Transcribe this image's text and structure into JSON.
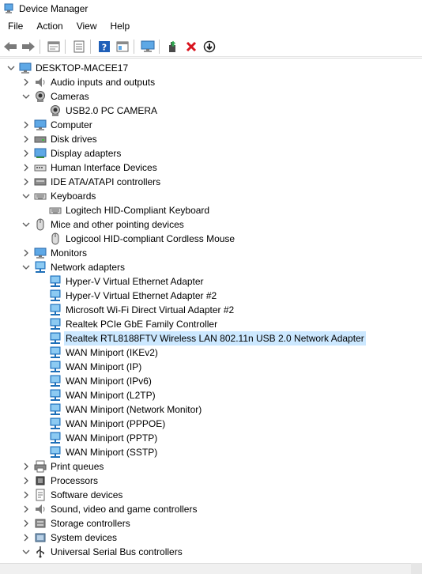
{
  "window": {
    "title": "Device Manager"
  },
  "menu": [
    "File",
    "Action",
    "View",
    "Help"
  ],
  "toolbar": [
    "back",
    "forward",
    "properties-sheet",
    "list-view",
    "help",
    "resource-view",
    "scan-hardware",
    "update-driver",
    "uninstall",
    "disable"
  ],
  "tree": [
    {
      "label": "DESKTOP-MACEE17",
      "level": 0,
      "expander": "expanded",
      "icon": "computer-root"
    },
    {
      "label": "Audio inputs and outputs",
      "level": 1,
      "expander": "collapsed",
      "icon": "speaker"
    },
    {
      "label": "Cameras",
      "level": 1,
      "expander": "expanded",
      "icon": "camera"
    },
    {
      "label": "USB2.0 PC CAMERA",
      "level": 2,
      "expander": "none",
      "icon": "camera"
    },
    {
      "label": "Computer",
      "level": 1,
      "expander": "collapsed",
      "icon": "monitor"
    },
    {
      "label": "Disk drives",
      "level": 1,
      "expander": "collapsed",
      "icon": "disk"
    },
    {
      "label": "Display adapters",
      "level": 1,
      "expander": "collapsed",
      "icon": "display"
    },
    {
      "label": "Human Interface Devices",
      "level": 1,
      "expander": "collapsed",
      "icon": "hid"
    },
    {
      "label": "IDE ATA/ATAPI controllers",
      "level": 1,
      "expander": "collapsed",
      "icon": "ide"
    },
    {
      "label": "Keyboards",
      "level": 1,
      "expander": "expanded",
      "icon": "keyboard"
    },
    {
      "label": "Logitech HID-Compliant Keyboard",
      "level": 2,
      "expander": "none",
      "icon": "keyboard"
    },
    {
      "label": "Mice and other pointing devices",
      "level": 1,
      "expander": "expanded",
      "icon": "mouse"
    },
    {
      "label": "Logicool HID-compliant Cordless Mouse",
      "level": 2,
      "expander": "none",
      "icon": "mouse"
    },
    {
      "label": "Monitors",
      "level": 1,
      "expander": "collapsed",
      "icon": "monitor"
    },
    {
      "label": "Network adapters",
      "level": 1,
      "expander": "expanded",
      "icon": "network"
    },
    {
      "label": "Hyper-V Virtual Ethernet Adapter",
      "level": 2,
      "expander": "none",
      "icon": "network"
    },
    {
      "label": "Hyper-V Virtual Ethernet Adapter #2",
      "level": 2,
      "expander": "none",
      "icon": "network"
    },
    {
      "label": "Microsoft Wi-Fi Direct Virtual Adapter #2",
      "level": 2,
      "expander": "none",
      "icon": "network"
    },
    {
      "label": "Realtek PCIe GbE Family Controller",
      "level": 2,
      "expander": "none",
      "icon": "network"
    },
    {
      "label": "Realtek RTL8188FTV Wireless LAN 802.11n USB 2.0 Network Adapter",
      "level": 2,
      "expander": "none",
      "icon": "network",
      "selected": true
    },
    {
      "label": "WAN Miniport (IKEv2)",
      "level": 2,
      "expander": "none",
      "icon": "network"
    },
    {
      "label": "WAN Miniport (IP)",
      "level": 2,
      "expander": "none",
      "icon": "network"
    },
    {
      "label": "WAN Miniport (IPv6)",
      "level": 2,
      "expander": "none",
      "icon": "network"
    },
    {
      "label": "WAN Miniport (L2TP)",
      "level": 2,
      "expander": "none",
      "icon": "network"
    },
    {
      "label": "WAN Miniport (Network Monitor)",
      "level": 2,
      "expander": "none",
      "icon": "network"
    },
    {
      "label": "WAN Miniport (PPPOE)",
      "level": 2,
      "expander": "none",
      "icon": "network"
    },
    {
      "label": "WAN Miniport (PPTP)",
      "level": 2,
      "expander": "none",
      "icon": "network"
    },
    {
      "label": "WAN Miniport (SSTP)",
      "level": 2,
      "expander": "none",
      "icon": "network"
    },
    {
      "label": "Print queues",
      "level": 1,
      "expander": "collapsed",
      "icon": "printer"
    },
    {
      "label": "Processors",
      "level": 1,
      "expander": "collapsed",
      "icon": "processor"
    },
    {
      "label": "Software devices",
      "level": 1,
      "expander": "collapsed",
      "icon": "software"
    },
    {
      "label": "Sound, video and game controllers",
      "level": 1,
      "expander": "collapsed",
      "icon": "speaker"
    },
    {
      "label": "Storage controllers",
      "level": 1,
      "expander": "collapsed",
      "icon": "storage"
    },
    {
      "label": "System devices",
      "level": 1,
      "expander": "collapsed",
      "icon": "system"
    },
    {
      "label": "Universal Serial Bus controllers",
      "level": 1,
      "expander": "expanded",
      "icon": "usb"
    }
  ],
  "colors": {
    "selection": "#cce8ff",
    "network_blue": "#1e88d6",
    "chevron": "#555555"
  }
}
